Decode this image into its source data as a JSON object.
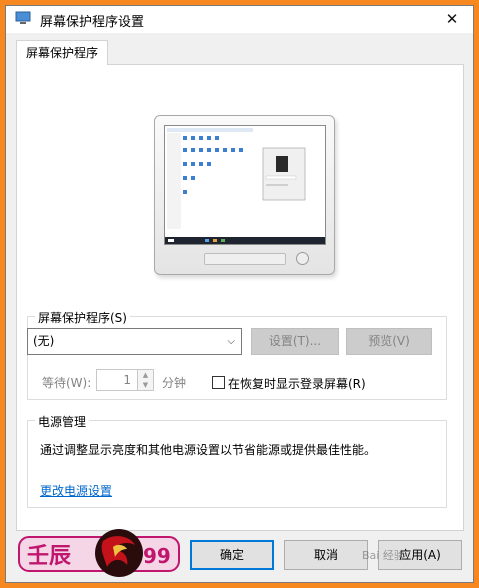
{
  "window": {
    "title": "屏幕保护程序设置",
    "close_symbol": "✕"
  },
  "tab": {
    "label": "屏幕保护程序"
  },
  "screensaver": {
    "group_label": "屏幕保护程序(S)",
    "selected": "(无)",
    "settings_label": "设置(T)...",
    "preview_label": "预览(V)",
    "wait_label": "等待(W):",
    "wait_value": "1",
    "minutes_label": "分钟",
    "resume_label": "在恢复时显示登录屏幕(R)",
    "resume_checked": false
  },
  "power": {
    "group_label": "电源管理",
    "description": "通过调整显示亮度和其他电源设置以节省能源或提供最佳性能。",
    "link_label": "更改电源设置"
  },
  "buttons": {
    "ok": "确定",
    "cancel": "取消",
    "apply": "应用(A)"
  },
  "watermark": {
    "text_left": "壬辰",
    "text_right": "99",
    "site": "Bai 经验"
  },
  "colors": {
    "frame": "#f6881f",
    "accent": "#0078d7",
    "link": "#0066cc"
  }
}
